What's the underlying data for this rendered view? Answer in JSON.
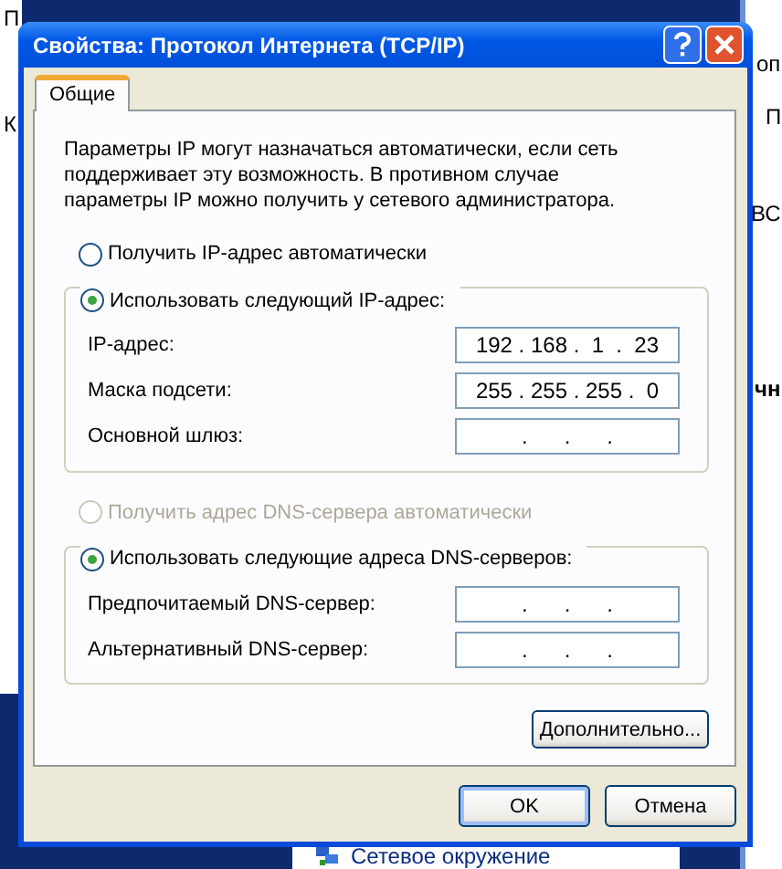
{
  "background": {
    "fragments": [
      "П",
      "К",
      "оп",
      "П",
      "ВС",
      "чн"
    ],
    "taskbar_item": "Сетевое окружение"
  },
  "window": {
    "title": "Свойства: Протокол Интернета (TCP/IP)"
  },
  "tabs": [
    {
      "label": "Общие",
      "selected": true
    }
  ],
  "description": "Параметры IP могут назначаться автоматически, если сеть поддерживает эту возможность. В противном случае параметры IP можно получить у сетевого администратора.",
  "ip_section": {
    "auto_option": {
      "label": "Получить IP-адрес автоматически",
      "selected": false,
      "disabled": false
    },
    "manual_option": {
      "label": "Использовать следующий IP-адрес:",
      "selected": true,
      "disabled": false
    },
    "fields": [
      {
        "label": "IP-адрес:",
        "value": "192 . 168 .  1  .  23"
      },
      {
        "label": "Маска подсети:",
        "value": "255 . 255 . 255 .  0"
      },
      {
        "label": "Основной шлюз:",
        "value": ".      .      ."
      }
    ]
  },
  "dns_section": {
    "auto_option": {
      "label": "Получить адрес DNS-сервера автоматически",
      "selected": false,
      "disabled": true
    },
    "manual_option": {
      "label": "Использовать следующие адреса DNS-серверов:",
      "selected": true,
      "disabled": false
    },
    "fields": [
      {
        "label": "Предпочитаемый DNS-сервер:",
        "value": ".      .      ."
      },
      {
        "label": "Альтернативный DNS-сервер:",
        "value": ".      .      ."
      }
    ]
  },
  "advanced_button": "Дополнительно...",
  "buttons": [
    {
      "label": "OK",
      "default": true
    },
    {
      "label": "Отмена",
      "default": false
    }
  ]
}
